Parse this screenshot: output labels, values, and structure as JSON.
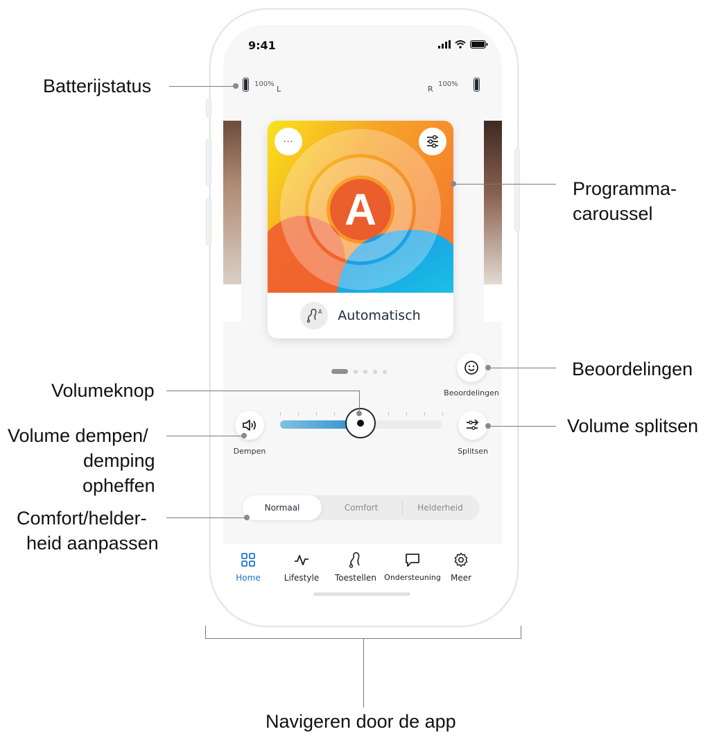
{
  "status_bar": {
    "time": "9:41"
  },
  "battery": {
    "left_percent": "100%",
    "left_side": "L",
    "right_percent": "100%",
    "right_side": "R"
  },
  "carousel": {
    "program_letter": "A",
    "program_label": "Automatisch",
    "more_button_label": "···",
    "prog_icon_superscript": "A",
    "active_index": 1,
    "total_pages": 5
  },
  "feedback": {
    "label": "Beoordelingen"
  },
  "volume": {
    "level": 0.49,
    "mute_label": "Dempen",
    "split_label": "Splitsen"
  },
  "sound_mode": {
    "options": [
      "Normaal",
      "Comfort",
      "Helderheid"
    ],
    "selected": "Normaal"
  },
  "tabbar": {
    "items": [
      {
        "label": "Home",
        "icon": "grid-icon",
        "active": true
      },
      {
        "label": "Lifestyle",
        "icon": "activity-icon",
        "active": false
      },
      {
        "label": "Toestellen",
        "icon": "hearing-aid-icon",
        "active": false
      },
      {
        "label": "Ondersteuning",
        "icon": "chat-bubble-icon",
        "active": false
      },
      {
        "label": "Meer",
        "icon": "gear-icon",
        "active": false
      }
    ]
  },
  "colors": {
    "accent": "#1a74c9",
    "slider_fill": "#2f8fd0"
  },
  "callouts": {
    "battery": "Batterijstatus",
    "carousel_line1": "Programma-",
    "carousel_line2": "caroussel",
    "feedback": "Beoordelingen",
    "volume_knob": "Volumeknop",
    "mute_line1": "Volume dempen/",
    "mute_line2": "demping",
    "mute_line3": "opheffen",
    "split": "Volume splitsen",
    "comfort_line1": "Comfort/helder-",
    "comfort_line2": "heid  aanpassen",
    "navigate": "Navigeren door de app"
  }
}
